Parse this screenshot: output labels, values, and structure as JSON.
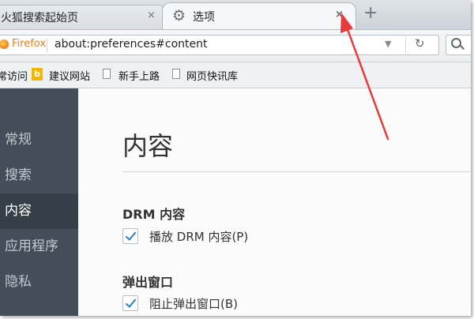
{
  "tabs": [
    {
      "title": "火狐搜索起始页",
      "active": false
    },
    {
      "title": "选项",
      "active": true
    }
  ],
  "new_tab_label": "+",
  "close_glyph": "×",
  "urlbar": {
    "identity_label": "Firefox",
    "url": "about:preferences#content"
  },
  "bookmarks": [
    {
      "label": "常访问",
      "icon": "none"
    },
    {
      "label": "建议网站",
      "icon": "bing-icon"
    },
    {
      "label": "新手上路",
      "icon": "page-icon"
    },
    {
      "label": "网页快讯库",
      "icon": "page-icon"
    }
  ],
  "sidebar": {
    "items": [
      {
        "label": "常规",
        "selected": false
      },
      {
        "label": "搜索",
        "selected": false
      },
      {
        "label": "内容",
        "selected": true
      },
      {
        "label": "应用程序",
        "selected": false
      },
      {
        "label": "隐私",
        "selected": false
      }
    ]
  },
  "content": {
    "title": "内容",
    "sections": [
      {
        "heading": "DRM 内容",
        "checkbox_label": "播放 DRM 内容(P)",
        "checked": true
      },
      {
        "heading": "弹出窗口",
        "checkbox_label": "阻止弹出窗口(B)",
        "checked": true
      }
    ]
  },
  "colors": {
    "sidebar_bg": "#424f5a",
    "sidebar_selected_bg": "#343f48",
    "accent_check": "#2a7cd3",
    "annotation_arrow": "#e83a3a"
  }
}
